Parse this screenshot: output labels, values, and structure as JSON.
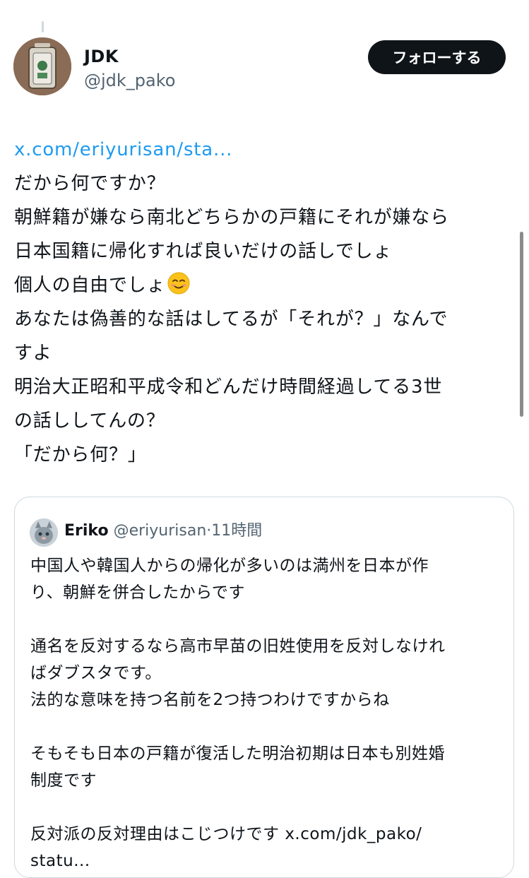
{
  "post": {
    "author": {
      "name": "JDK",
      "handle": "@jdk_pako"
    },
    "follow_label": "フォローする",
    "link": "x.com/eriyurisan/sta...",
    "lines": [
      "だから何ですか？",
      "朝鮮籍が嫌なら南北どちらかの戸籍にそれが嫌なら",
      "日本国籍に帰化すれば良いだけの話しでしょ",
      "個人の自由でしょ",
      "あなたは偽善的な話はしてるが「それが？」なんで",
      "すよ",
      "明治大正昭和平成令和どんだけ時間経過してる3世",
      "の話ししてんの？",
      "「だから何？」"
    ],
    "emoji": "smiling-face-emoji"
  },
  "quote": {
    "name": "Eriko",
    "handle": "@eriyurisan",
    "separator": "·",
    "time": "11時間",
    "lines": [
      "中国人や韓国人からの帰化が多いのは満州を日本が作",
      "り、朝鮮を併合したからです",
      "",
      "通名を反対するなら高市早苗の旧姓使用を反対しなけれ",
      "ばダブスタです。",
      "法的な意味を持つ名前を2つ持つわけですからね",
      "",
      "そもそも日本の戸籍が復活した明治初期は日本も別姓婚",
      "制度です",
      "",
      "反対派の反対理由はこじつけです"
    ],
    "link_part1": "x.com/jdk_pako/",
    "link_part2": "statu..."
  },
  "colors": {
    "text": "#0f1419",
    "secondary": "#536471",
    "link": "#1d9bf0",
    "button_bg": "#0f1419",
    "border": "#cfd9de"
  }
}
